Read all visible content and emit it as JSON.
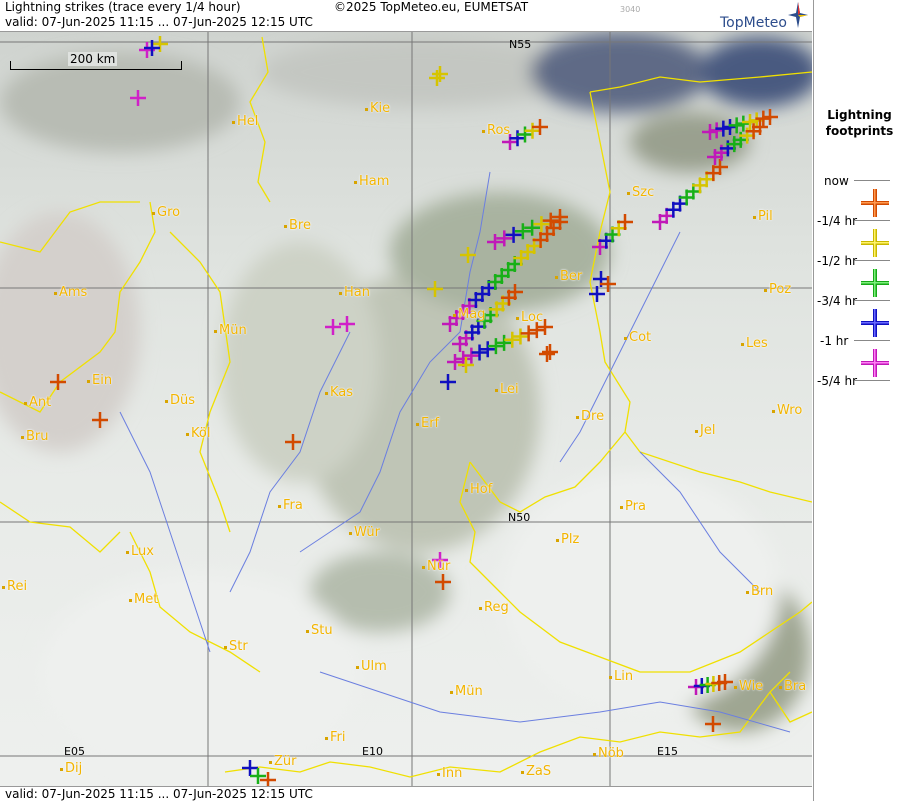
{
  "header": {
    "title": "Lightning strikes (trace every 1/4 hour)",
    "credit": "©2025 TopMeteo.eu, EUMETSAT",
    "code": "3040",
    "valid": "valid:  07-Jun-2025 11:15 ... 07-Jun-2025 12:15 UTC",
    "brand": "TopMeteo"
  },
  "footer": {
    "valid": "valid:  07-Jun-2025 11:15 ... 07-Jun-2025 12:15 UTC"
  },
  "scale": {
    "label": "200 km"
  },
  "grid_labels": [
    "N55",
    "N50",
    "E05",
    "E10",
    "E15"
  ],
  "cities": [
    "Hel",
    "Kie",
    "Ros",
    "Szc",
    "Pil",
    "Ham",
    "Gro",
    "Bre",
    "Ber",
    "Poz",
    "Ams",
    "Han",
    "Mün",
    "Mag",
    "Loc",
    "Cot",
    "Les",
    "Ein",
    "Ant",
    "Düs",
    "Kas",
    "Lei",
    "Bru",
    "Köl",
    "Erf",
    "Dre",
    "Jel",
    "Wro",
    "Hof",
    "Fra",
    "Pra",
    "Wür",
    "Plz",
    "Lux",
    "Nür",
    "Rei",
    "Met",
    "Reg",
    "Brn",
    "Str",
    "Stu",
    "Ulm",
    "Lin",
    "Wie",
    "Bra",
    "Mün",
    "Fri",
    "Dij",
    "Zür",
    "Inn",
    "ZaS",
    "Nöb"
  ],
  "legend": {
    "title_line1": "Lightning",
    "title_line2": "footprints",
    "entries": [
      {
        "label": "now",
        "color": "#d24a00"
      },
      {
        "label": "-1/4 hr",
        "color": "#e6d200"
      },
      {
        "label": "-1/2 hr",
        "color": "#1fc21f"
      },
      {
        "label": "-3/4 hr",
        "color": "#1010c0"
      },
      {
        "label": "-1 hr",
        "color": "#d020c8"
      },
      {
        "label": "-5/4 hr",
        "color": ""
      }
    ]
  },
  "colors": {
    "border": "#f0e000",
    "river": "#6b7fe0",
    "grid": "#777777",
    "city_label": "#f2b400"
  }
}
